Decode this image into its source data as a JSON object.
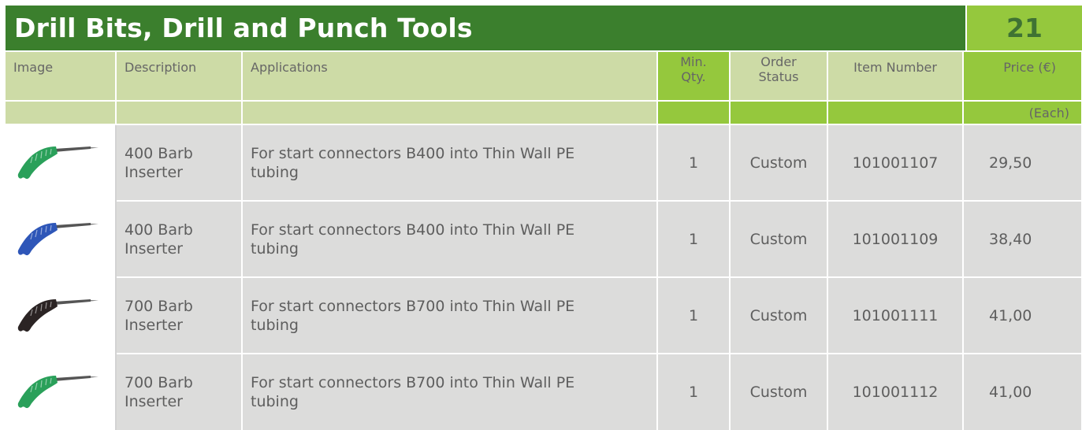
{
  "header": {
    "title": "Drill Bits, Drill and Punch Tools",
    "page_number": "21"
  },
  "columns": {
    "image": "Image",
    "description": "Description",
    "applications": "Applications",
    "min_qty_line1": "Min.",
    "min_qty_line2": "Qty.",
    "order_status_line1": "Order",
    "order_status_line2": "Status",
    "item_number": "Item Number",
    "price": "Price (€)",
    "price_unit": "(Each)"
  },
  "rows": [
    {
      "image_icon": "green-barb-inserter-tool",
      "tool_color": "#2aa05a",
      "desc_line1": "400 Barb",
      "desc_line2": "Inserter",
      "application": "For start connectors B400 into Thin Wall PE tubing",
      "min_qty": "1",
      "order_status": "Custom",
      "item_number": "101001107",
      "price": "29,50"
    },
    {
      "image_icon": "blue-barb-inserter-tool",
      "tool_color": "#2e56b8",
      "desc_line1": "400 Barb",
      "desc_line2": "Inserter",
      "application": "For start connectors B400 into Thin Wall PE tubing",
      "min_qty": "1",
      "order_status": "Custom",
      "item_number": "101001109",
      "price": "38,40"
    },
    {
      "image_icon": "black-barb-inserter-tool",
      "tool_color": "#2b2424",
      "desc_line1": "700 Barb",
      "desc_line2": "Inserter",
      "application": "For start connectors B700 into Thin Wall PE tubing",
      "min_qty": "1",
      "order_status": "Custom",
      "item_number": "101001111",
      "price": "41,00"
    },
    {
      "image_icon": "green-barb-inserter-tool",
      "tool_color": "#2aa05a",
      "desc_line1": "700 Barb",
      "desc_line2": "Inserter",
      "application": "For start connectors B700 into Thin Wall PE tubing",
      "min_qty": "1",
      "order_status": "Custom",
      "item_number": "101001112",
      "price": "41,00"
    }
  ],
  "colors": {
    "title_bar": "#3b7f2d",
    "page_number_bg": "#95c83d",
    "header_light": "#cddba6",
    "header_bright": "#95c83d",
    "row_bg": "#dcdcdb"
  }
}
